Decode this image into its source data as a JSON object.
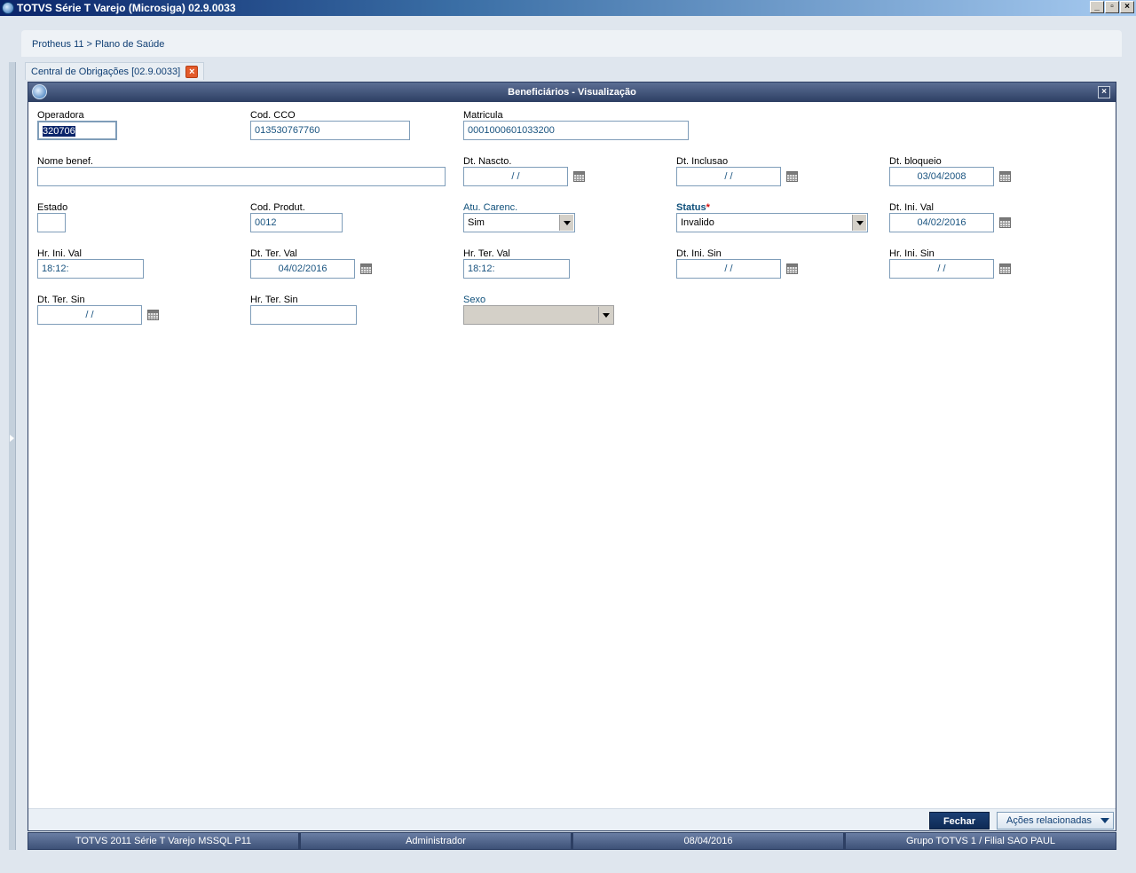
{
  "app": {
    "title": "TOTVS Série T Varejo (Microsiga) 02.9.0033",
    "window_buttons": [
      "_",
      "▫",
      "×"
    ]
  },
  "breadcrumb": "Protheus 11 > Plano de Saúde",
  "tab": {
    "label": "Central de Obrigações [02.9.0033]",
    "close": "×"
  },
  "dialog": {
    "title": "Beneficiários - Visualização",
    "close": "×",
    "fields": {
      "operadora": {
        "label": "Operadora",
        "value": "320706"
      },
      "cod_cco": {
        "label": "Cod. CCO",
        "value": "013530767760"
      },
      "matricula": {
        "label": "Matricula",
        "value": "0001000601033200"
      },
      "nome_benef": {
        "label": "Nome benef.",
        "value": ""
      },
      "dt_nascto": {
        "label": "Dt. Nascto.",
        "value": "/ /"
      },
      "dt_inclusao": {
        "label": "Dt. Inclusao",
        "value": "/ /"
      },
      "dt_bloqueio": {
        "label": "Dt. bloqueio",
        "value": "03/04/2008"
      },
      "estado": {
        "label": "Estado",
        "value": ""
      },
      "cod_produt": {
        "label": "Cod. Produt.",
        "value": "0012"
      },
      "atu_carenc": {
        "label": "Atu. Carenc.",
        "value": "Sim"
      },
      "status": {
        "label": "Status",
        "required_mark": "*",
        "value": "Invalido"
      },
      "dt_ini_val": {
        "label": "Dt. Ini. Val",
        "value": "04/02/2016"
      },
      "hr_ini_val": {
        "label": "Hr. Ini. Val",
        "value": "18:12:"
      },
      "dt_ter_val": {
        "label": "Dt. Ter. Val",
        "value": "04/02/2016"
      },
      "hr_ter_val": {
        "label": "Hr. Ter. Val",
        "value": "18:12:"
      },
      "dt_ini_sin": {
        "label": "Dt. Ini. Sin",
        "value": "/ /"
      },
      "hr_ini_sin": {
        "label": "Hr. Ini. Sin",
        "value": "/ /"
      },
      "dt_ter_sin": {
        "label": "Dt. Ter. Sin",
        "value": "/ /"
      },
      "hr_ter_sin": {
        "label": "Hr. Ter. Sin",
        "value": ""
      },
      "sexo": {
        "label": "Sexo",
        "value": ""
      }
    },
    "footer": {
      "close_label": "Fechar",
      "actions_label": "Ações relacionadas"
    }
  },
  "statusbar": [
    "TOTVS 2011 Série T Varejo MSSQL P11",
    "Administrador",
    "08/04/2016",
    "Grupo TOTVS 1 / Filial SAO PAUL"
  ],
  "colors": {
    "label_blue": "#0e4f7a",
    "input_text": "#1a5480",
    "required": "#d01010",
    "dialog_title_bg": "#2d3f63"
  }
}
